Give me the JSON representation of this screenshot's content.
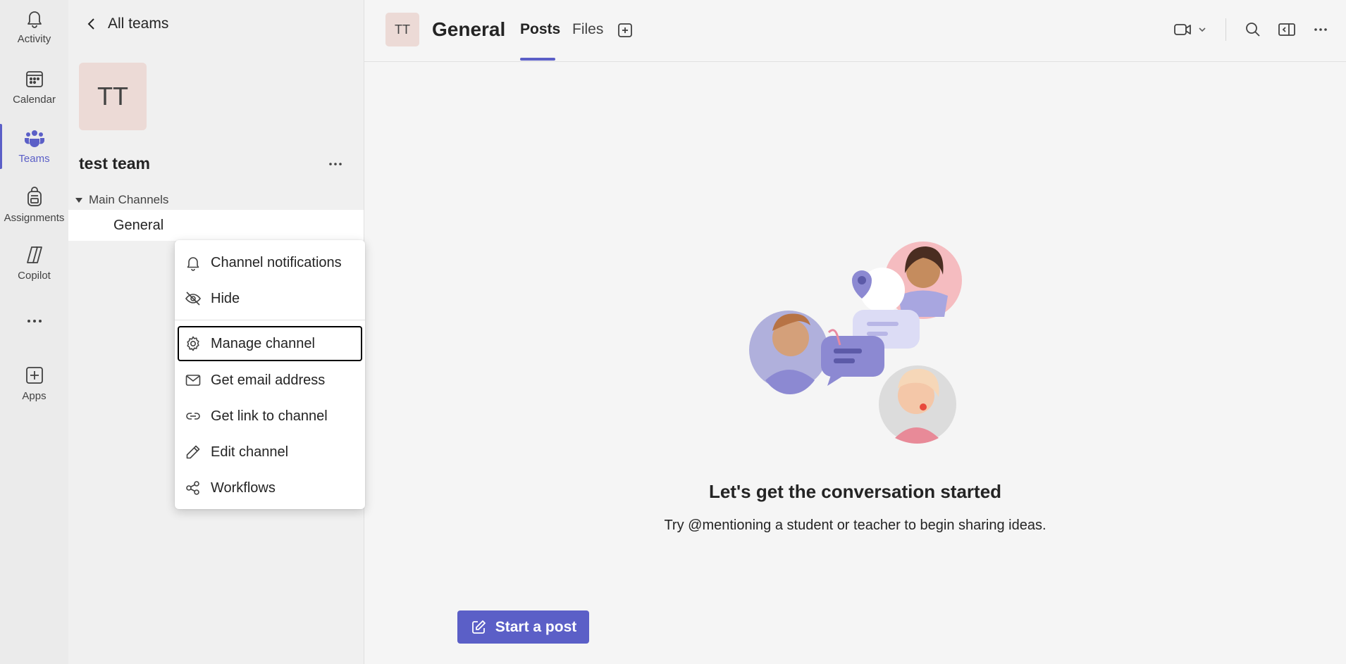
{
  "rail": {
    "items": [
      {
        "label": "Activity",
        "icon": "bell-icon"
      },
      {
        "label": "Calendar",
        "icon": "calendar-icon"
      },
      {
        "label": "Teams",
        "icon": "teams-icon",
        "active": true
      },
      {
        "label": "Assignments",
        "icon": "backpack-icon"
      },
      {
        "label": "Copilot",
        "icon": "copilot-icon"
      },
      {
        "label": "",
        "icon": "more-icon"
      },
      {
        "label": "Apps",
        "icon": "add-app-icon"
      }
    ]
  },
  "team_panel": {
    "back_label": "All teams",
    "team_initials": "TT",
    "team_name": "test team",
    "section_label": "Main Channels",
    "channel_name": "General"
  },
  "context_menu": {
    "items": [
      {
        "label": "Channel notifications",
        "icon": "bell-icon"
      },
      {
        "label": "Hide",
        "icon": "eye-off-icon"
      },
      {
        "label": "Manage channel",
        "icon": "gear-icon",
        "focused": true
      },
      {
        "label": "Get email address",
        "icon": "mail-icon"
      },
      {
        "label": "Get link to channel",
        "icon": "link-icon"
      },
      {
        "label": "Edit channel",
        "icon": "pencil-icon"
      },
      {
        "label": "Workflows",
        "icon": "workflows-icon"
      }
    ]
  },
  "header": {
    "channel_initials": "TT",
    "channel_title": "General",
    "tabs": [
      {
        "label": "Posts",
        "active": true
      },
      {
        "label": "Files"
      }
    ]
  },
  "empty_state": {
    "title": "Let's get the conversation started",
    "subtitle": "Try @mentioning a student or teacher to begin sharing ideas."
  },
  "start_post_label": "Start a post",
  "colors": {
    "accent": "#5b5fc7",
    "rail_bg": "#ebebeb",
    "avatar_bg": "#ecdad6"
  }
}
